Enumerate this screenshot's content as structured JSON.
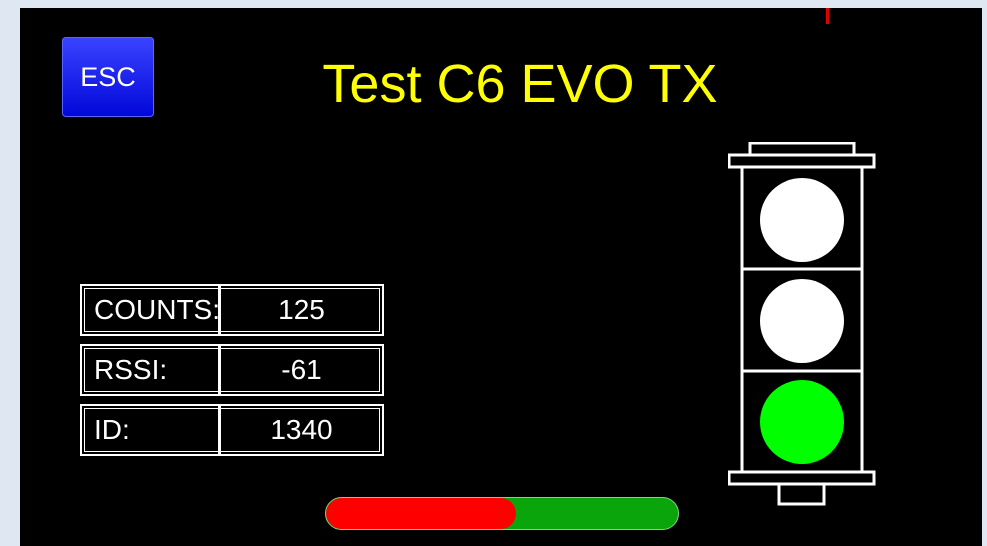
{
  "app": {
    "title": "Test C6 EVO TX",
    "esc_label": "ESC"
  },
  "stats": [
    {
      "label": "COUNTS:",
      "value": "125"
    },
    {
      "label": "RSSI:",
      "value": "-61"
    },
    {
      "label": "ID:",
      "value": "1340"
    }
  ],
  "progress": {
    "fraction": 0.54
  },
  "traffic_light": {
    "lights": [
      {
        "name": "top",
        "color": "#ffffff"
      },
      {
        "name": "middle",
        "color": "#ffffff"
      },
      {
        "name": "bottom",
        "color": "#00ff00"
      }
    ]
  },
  "colors": {
    "screen_bg": "#000000",
    "title": "#ffff00",
    "esc_button": "#0a14f0",
    "progress_fill": "#ff0000",
    "progress_track": "#0aa50a",
    "marker": "#e00000"
  }
}
